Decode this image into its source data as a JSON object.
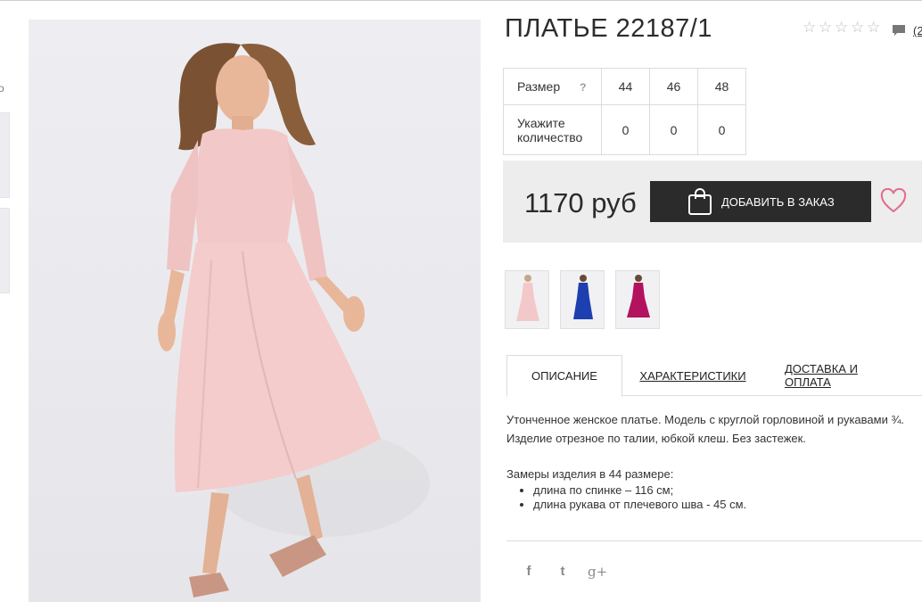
{
  "product": {
    "title": "ПЛАТЬЕ 22187/1",
    "rating_icon": "star-outline-icon",
    "review_link": "(2",
    "colors": {
      "dress_pink": "#f2c9c8",
      "dress_blue": "#1d3fb0",
      "dress_magenta": "#b3125e"
    }
  },
  "left_sliver": {
    "glyph": "о"
  },
  "size_table": {
    "size_label": "Размер",
    "help": "?",
    "sizes": [
      "44",
      "46",
      "48"
    ],
    "qty_label": "Укажите количество",
    "quantities": [
      "0",
      "0",
      "0"
    ]
  },
  "purchase": {
    "price": "1170 руб",
    "add_button": "ДОБАВИТЬ В ЗАКАЗ",
    "add_icon": "shopping-bag-icon",
    "wishlist_icon": "heart-icon",
    "accent_heart": "#e46b8c"
  },
  "tabs": {
    "description": "ОПИСАНИЕ",
    "specs": "ХАРАКТЕРИСТИКИ",
    "delivery": "ДОСТАВКА И ОПЛАТА"
  },
  "description": {
    "line1": "Утонченное женское платье. Модель с круглой горловиной и рукавами ¾.",
    "line2": "Изделие отрезное по талии, юбкой клеш. Без застежек.",
    "measures_title": "Замеры изделия в 44 размере:",
    "measure1": "длина по спинке – 116 см;",
    "measure2": "длина рукава от плечевого шва - 45 см."
  },
  "social": {
    "facebook": "f",
    "twitter": "t",
    "google": "g+"
  }
}
